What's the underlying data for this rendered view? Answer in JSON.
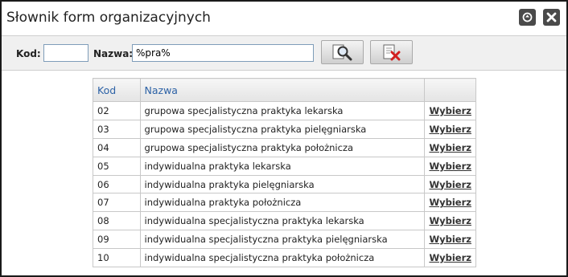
{
  "window": {
    "title": "Słownik form organizacyjnych",
    "buttons": {
      "refresh_icon": "refresh-icon",
      "close_icon": "close-icon"
    }
  },
  "filter": {
    "kod_label": "Kod:",
    "kod_value": "",
    "nazwa_label": "Nazwa:",
    "nazwa_value": "%pra%",
    "search_icon": "search-icon",
    "clear_icon": "clear-icon"
  },
  "table": {
    "headers": [
      "Kod",
      "Nazwa",
      ""
    ],
    "action_label": "Wybierz",
    "rows": [
      {
        "kod": "02",
        "nazwa": "grupowa specjalistyczna praktyka lekarska"
      },
      {
        "kod": "03",
        "nazwa": "grupowa specjalistyczna praktyka pielęgniarska"
      },
      {
        "kod": "04",
        "nazwa": "grupowa specjalistyczna praktyka położnicza"
      },
      {
        "kod": "05",
        "nazwa": "indywidualna praktyka lekarska"
      },
      {
        "kod": "06",
        "nazwa": "indywidualna praktyka pielęgniarska"
      },
      {
        "kod": "07",
        "nazwa": "indywidualna praktyka położnicza"
      },
      {
        "kod": "08",
        "nazwa": "indywidualna specjalistyczna praktyka lekarska"
      },
      {
        "kod": "09",
        "nazwa": "indywidualna specjalistyczna praktyka pielęgniarska"
      },
      {
        "kod": "10",
        "nazwa": "indywidualna specjalistyczna praktyka położnicza"
      }
    ]
  },
  "colors": {
    "header_text": "#2d62a6",
    "border": "#1a1a1a"
  }
}
